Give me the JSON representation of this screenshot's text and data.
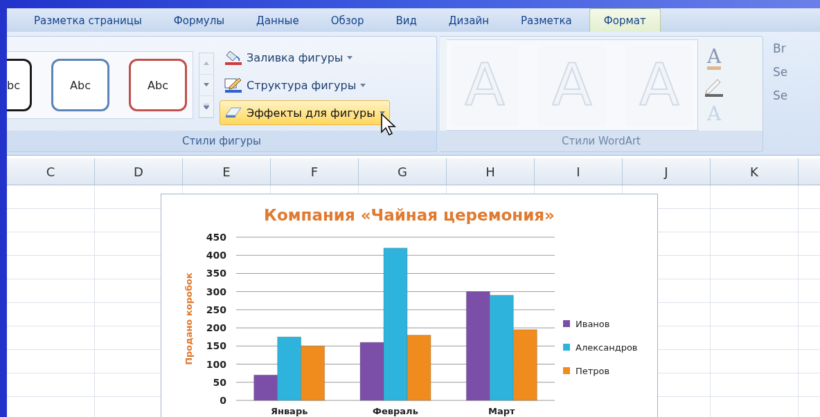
{
  "tabs": [
    {
      "label": "Разметка страницы",
      "selected": false
    },
    {
      "label": "Формулы",
      "selected": false
    },
    {
      "label": "Данные",
      "selected": false
    },
    {
      "label": "Обзор",
      "selected": false
    },
    {
      "label": "Вид",
      "selected": false
    },
    {
      "label": "Дизайн",
      "selected": false
    },
    {
      "label": "Разметка",
      "selected": false
    },
    {
      "label": "Формат",
      "selected": true
    }
  ],
  "shape_styles": {
    "thumbnails": [
      {
        "label": "bc",
        "color": "#1a1a1a"
      },
      {
        "label": "Abc",
        "color": "#5b84b8"
      },
      {
        "label": "Abc",
        "color": "#c0504d"
      }
    ],
    "commands": [
      {
        "kind": "fill",
        "label": "Заливка фигуры",
        "highlighted": false
      },
      {
        "kind": "outline",
        "label": "Структура фигуры",
        "highlighted": false
      },
      {
        "kind": "effects",
        "label": "Эффекты для фигуры",
        "highlighted": true
      }
    ],
    "label": "Стили фигуры"
  },
  "wordart_styles": {
    "disabled": true,
    "thumbnails": [
      {
        "label": "A"
      },
      {
        "label": "A"
      },
      {
        "label": "A"
      }
    ],
    "tools": [
      {
        "kind": "text-fill",
        "label": "A"
      },
      {
        "kind": "text-outline"
      },
      {
        "kind": "text-effects",
        "label": "A"
      }
    ],
    "label": "Стили WordArt"
  },
  "arrange": {
    "items": [
      {
        "label": "Br"
      },
      {
        "label": "Se"
      },
      {
        "label": "Se"
      }
    ]
  },
  "columns": [
    "C",
    "D",
    "E",
    "F",
    "G",
    "H",
    "I",
    "J",
    "K"
  ],
  "chart": {
    "chart_data": {
      "type": "bar",
      "title": "Компания «Чайная церемония»",
      "ylabel": "Продано коробок",
      "categories": [
        "Январь",
        "Февраль",
        "Март"
      ],
      "series": [
        {
          "name": "Иванов",
          "color": "#7b4fa8",
          "values": [
            70,
            160,
            300
          ]
        },
        {
          "name": "Александров",
          "color": "#2eb4dc",
          "values": [
            175,
            420,
            290
          ]
        },
        {
          "name": "Петров",
          "color": "#f08c1e",
          "values": [
            150,
            180,
            195
          ]
        }
      ],
      "grid": true,
      "legend": true,
      "ylim": [
        0,
        450
      ],
      "yticks": [
        0,
        50,
        100,
        150,
        200,
        250,
        300,
        350,
        400,
        450
      ]
    }
  }
}
